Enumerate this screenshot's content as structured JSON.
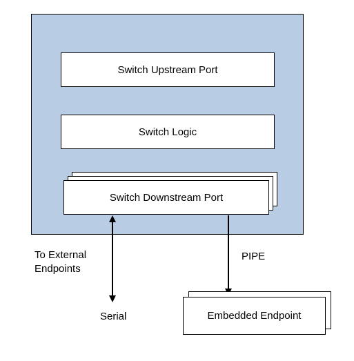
{
  "switch": {
    "upstream": "Switch Upstream Port",
    "logic": "Switch Logic",
    "downstream": "Switch Downstream Port"
  },
  "endpoint": {
    "label": "Embedded Endpoint"
  },
  "labels": {
    "external": "To External\nEndpoints",
    "pipe": "PIPE",
    "serial": "Serial"
  }
}
